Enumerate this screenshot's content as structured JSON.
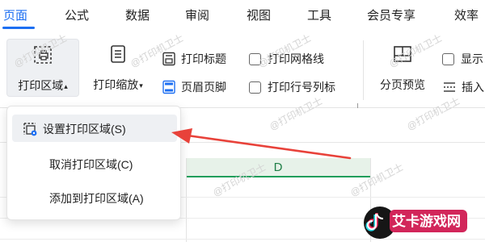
{
  "tabs": [
    {
      "label": "页面",
      "active": true
    },
    {
      "label": "公式"
    },
    {
      "label": "数据"
    },
    {
      "label": "审阅"
    },
    {
      "label": "视图"
    },
    {
      "label": "工具"
    },
    {
      "label": "会员专享"
    },
    {
      "label": "效率"
    }
  ],
  "ribbon": {
    "print_area": {
      "label": "打印区域",
      "icon": "print-area-icon"
    },
    "print_scale": {
      "label": "打印缩放",
      "icon": "print-scale-icon"
    },
    "print_titles": {
      "label": "打印标题",
      "icon": "print-titles-icon"
    },
    "header_footer": {
      "label": "页眉页脚",
      "icon": "header-footer-icon"
    },
    "print_gridlines": {
      "label": "打印网格线",
      "checked": false
    },
    "print_row_col_headers": {
      "label": "打印行号列标",
      "checked": false
    },
    "page_break_preview": {
      "label": "分页预览",
      "icon": "page-break-preview-icon"
    },
    "show_partial": {
      "label": "显示",
      "checked": false
    },
    "insert_partial": {
      "label": "插入",
      "icon": "insert-page-break-icon"
    }
  },
  "print_area_menu": {
    "items": [
      {
        "label": "设置打印区域(S)",
        "icon": "set-print-area-icon",
        "hovered": true
      },
      {
        "label": "取消打印区域(C)"
      },
      {
        "label": "添加到打印区域(A)"
      }
    ]
  },
  "sheet": {
    "selected_column": "D"
  },
  "watermark_text": "@打印机卫士",
  "logo_text": "艾卡游戏网",
  "colors": {
    "accent_blue": "#1d6ff2",
    "sheet_green": "#1e9e5a",
    "arrow_red": "#e8423a"
  }
}
